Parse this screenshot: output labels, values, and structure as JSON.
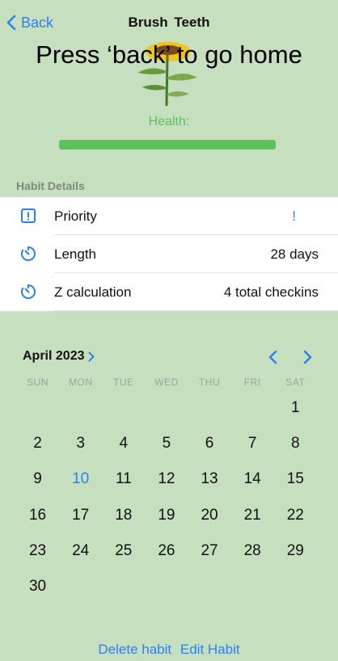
{
  "nav": {
    "back_label": "Back",
    "title": "Brush  Teeth"
  },
  "overlay_text": "Press ‘back’ to go home",
  "health": {
    "label": "Health:",
    "level": 1.0
  },
  "habit_details": {
    "section_title": "Habit Details",
    "rows": [
      {
        "icon": "exclamation-square-icon",
        "label": "Priority",
        "value": "!"
      },
      {
        "icon": "timer-icon",
        "label": "Length",
        "value": "28 days"
      },
      {
        "icon": "timer-icon",
        "label": "Z calculation",
        "value": "4 total checkins"
      }
    ]
  },
  "calendar": {
    "month_label": "April 2023",
    "weekdays": [
      "SUN",
      "MON",
      "TUE",
      "WED",
      "THU",
      "FRI",
      "SAT"
    ],
    "weeks": [
      [
        "",
        "",
        "",
        "",
        "",
        "",
        "1"
      ],
      [
        "2",
        "3",
        "4",
        "5",
        "6",
        "7",
        "8"
      ],
      [
        "9",
        "10",
        "11",
        "12",
        "13",
        "14",
        "15"
      ],
      [
        "16",
        "17",
        "18",
        "19",
        "20",
        "21",
        "22"
      ],
      [
        "23",
        "24",
        "25",
        "26",
        "27",
        "28",
        "29"
      ],
      [
        "30",
        "",
        "",
        "",
        "",
        "",
        ""
      ]
    ],
    "highlighted_day": "10"
  },
  "actions": {
    "delete_label": "Delete habit",
    "edit_label": "Edit Habit"
  },
  "colors": {
    "accent": "#2f7ff0",
    "background": "#c6dfbe",
    "health": "#5cc15c"
  }
}
